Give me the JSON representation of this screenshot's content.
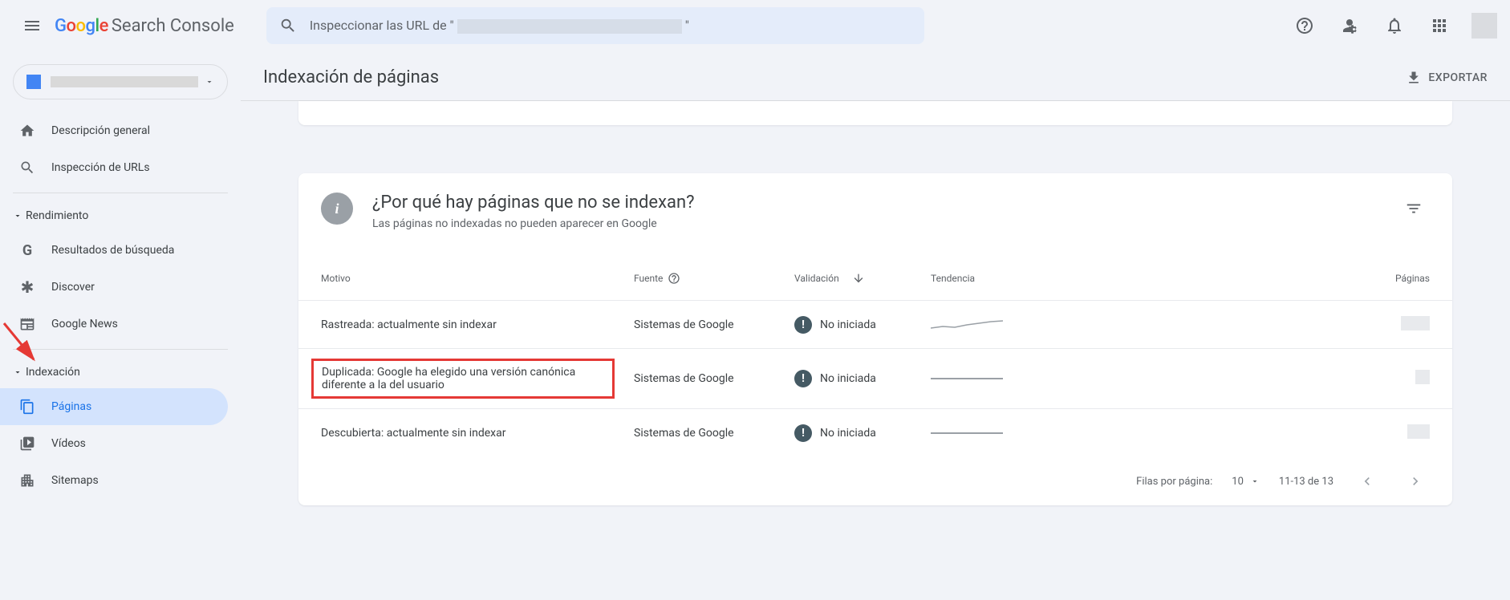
{
  "header": {
    "product_name": "Search Console",
    "search_prefix": "Inspeccionar las URL de \"",
    "search_suffix": "\""
  },
  "sidebar": {
    "items": {
      "overview": "Descripción general",
      "url_inspection": "Inspección de URLs"
    },
    "sections": {
      "performance": {
        "label": "Rendimiento",
        "items": {
          "search_results": "Resultados de búsqueda",
          "discover": "Discover",
          "google_news": "Google News"
        }
      },
      "indexing": {
        "label": "Indexación",
        "items": {
          "pages": "Páginas",
          "videos": "Vídeos",
          "sitemaps": "Sitemaps"
        }
      }
    }
  },
  "page": {
    "title": "Indexación de páginas",
    "export_label": "EXPORTAR"
  },
  "card": {
    "title": "¿Por qué hay páginas que no se indexan?",
    "subtitle": "Las páginas no indexadas no pueden aparecer en Google",
    "columns": {
      "motivo": "Motivo",
      "fuente": "Fuente",
      "validacion": "Validación",
      "tendencia": "Tendencia",
      "paginas": "Páginas"
    },
    "rows": [
      {
        "motivo": "Rastreada: actualmente sin indexar",
        "fuente": "Sistemas de Google",
        "validacion": "No iniciada"
      },
      {
        "motivo": "Duplicada: Google ha elegido una versión canónica diferente a la del usuario",
        "fuente": "Sistemas de Google",
        "validacion": "No iniciada"
      },
      {
        "motivo": "Descubierta: actualmente sin indexar",
        "fuente": "Sistemas de Google",
        "validacion": "No iniciada"
      }
    ],
    "footer": {
      "rows_per_page_label": "Filas por página:",
      "rows_per_page_value": "10",
      "range": "11-13 de 13"
    }
  }
}
